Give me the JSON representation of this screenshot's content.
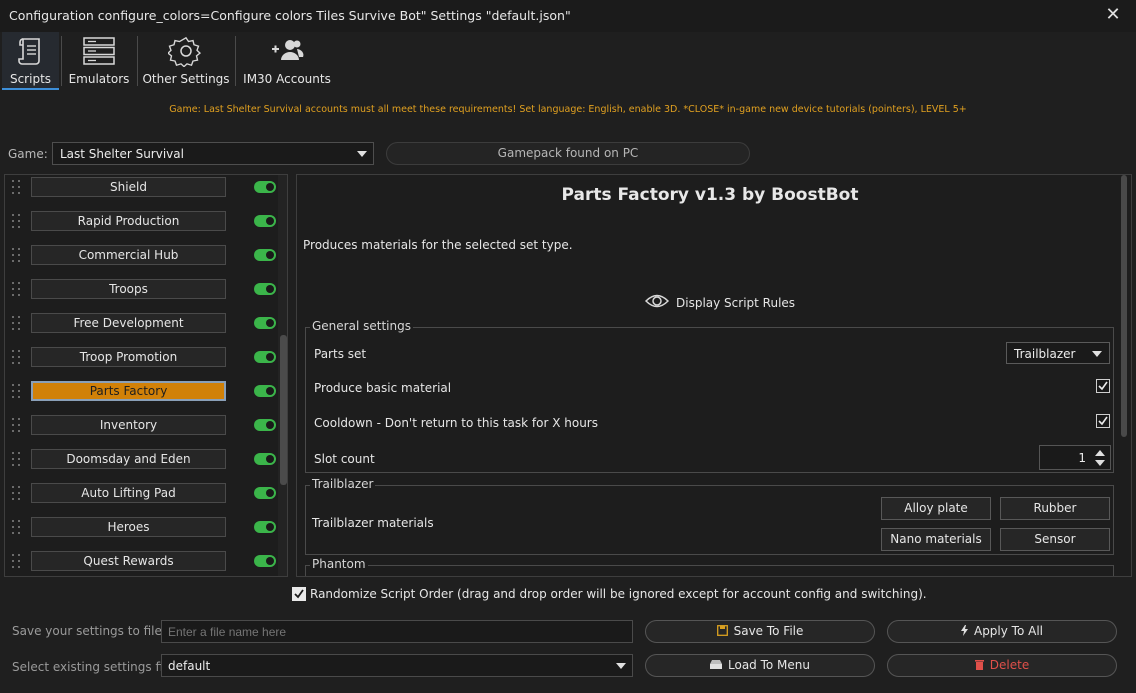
{
  "window": {
    "title": "Configuration configure_colors=Configure colors Tiles Survive Bot\" Settings \"default.json\"",
    "close_glyph": "✕"
  },
  "tabs": [
    {
      "label": "Scripts",
      "icon": "scroll-icon",
      "active": true
    },
    {
      "label": "Emulators",
      "icon": "server-icon"
    },
    {
      "label": "Other Settings",
      "icon": "gear-icon"
    },
    {
      "label": "IM30 Accounts",
      "icon": "users-icon"
    }
  ],
  "notice": "Game: Last Shelter Survival accounts must all meet these requirements! Set language: English, enable 3D. *CLOSE* in-game new device tutorials (pointers), LEVEL 5+",
  "game": {
    "label": "Game:",
    "selected": "Last Shelter Survival",
    "gamepack_status": "Gamepack found on PC"
  },
  "scripts": [
    {
      "label": "Shield",
      "enabled": true
    },
    {
      "label": "Rapid Production",
      "enabled": true
    },
    {
      "label": "Commercial Hub",
      "enabled": true
    },
    {
      "label": "Troops",
      "enabled": true
    },
    {
      "label": "Free Development",
      "enabled": true
    },
    {
      "label": "Troop Promotion",
      "enabled": true
    },
    {
      "label": "Parts Factory",
      "enabled": true,
      "active": true
    },
    {
      "label": "Inventory",
      "enabled": true
    },
    {
      "label": "Doomsday and Eden",
      "enabled": true
    },
    {
      "label": "Auto Lifting Pad",
      "enabled": true
    },
    {
      "label": "Heroes",
      "enabled": true
    },
    {
      "label": "Quest Rewards",
      "enabled": true
    }
  ],
  "detail": {
    "title": "Parts Factory v1.3 by BoostBot",
    "description": "Produces materials for the selected set type.",
    "rules_label": "Display Script Rules",
    "general": {
      "legend": "General settings",
      "parts_set_label": "Parts set",
      "parts_set_value": "Trailblazer",
      "produce_basic_label": "Produce basic material",
      "produce_basic_checked": true,
      "cooldown_label": "Cooldown - Don't return to this task for X hours",
      "cooldown_checked": true,
      "slot_count_label": "Slot count",
      "slot_count_value": "1"
    },
    "trailblazer": {
      "legend": "Trailblazer",
      "materials_label": "Trailblazer materials",
      "materials": [
        "Alloy plate",
        "Rubber",
        "Nano materials",
        "Sensor"
      ]
    },
    "phantom": {
      "legend": "Phantom"
    }
  },
  "randomize": {
    "checked": true,
    "label": "Randomize Script Order (drag and drop order will be ignored except for account config and switching)."
  },
  "bottom": {
    "save_label": "Save your settings to file",
    "file_placeholder": "Enter a file name here",
    "select_label": "Select existing settings file",
    "selected_file": "default",
    "save_to_file": "Save To File",
    "apply_to_all": "Apply To All",
    "load_to_menu": "Load To Menu",
    "delete": "Delete"
  },
  "colors": {
    "accent": "#d18108",
    "toggle_on": "#3bb54a",
    "notice": "#e0a020",
    "danger": "#e0504a",
    "tab_underline": "#3d8fd9"
  }
}
